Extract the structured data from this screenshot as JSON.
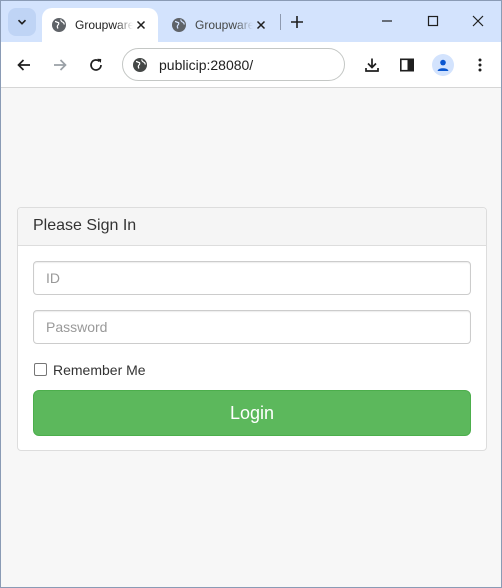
{
  "browser": {
    "tabs": [
      {
        "title": "Groupware",
        "active": true
      },
      {
        "title": "Groupware",
        "active": false
      }
    ],
    "address": "publicip:28080/"
  },
  "icons": {
    "tab_search": "chevron-down-icon",
    "favicon": "globe-icon",
    "tab_close": "close-icon",
    "new_tab": "plus-icon",
    "minimize": "minimize-icon",
    "maximize": "maximize-icon",
    "window_close": "close-icon",
    "back": "arrow-left-icon",
    "forward": "arrow-right-icon",
    "reload": "reload-icon",
    "site_info": "tune-icon",
    "download": "download-icon",
    "side_panel": "side-panel-icon",
    "profile": "profile-icon",
    "menu": "kebab-menu-icon"
  },
  "colors": {
    "tabstrip": "#d3e3fd",
    "login_button": "#5cb85c",
    "page_background": "#f7f7f7"
  },
  "login": {
    "heading": "Please Sign In",
    "id_placeholder": "ID",
    "id_value": "",
    "password_placeholder": "Password",
    "password_value": "",
    "remember_label": "Remember Me",
    "remember_checked": false,
    "button_label": "Login"
  }
}
